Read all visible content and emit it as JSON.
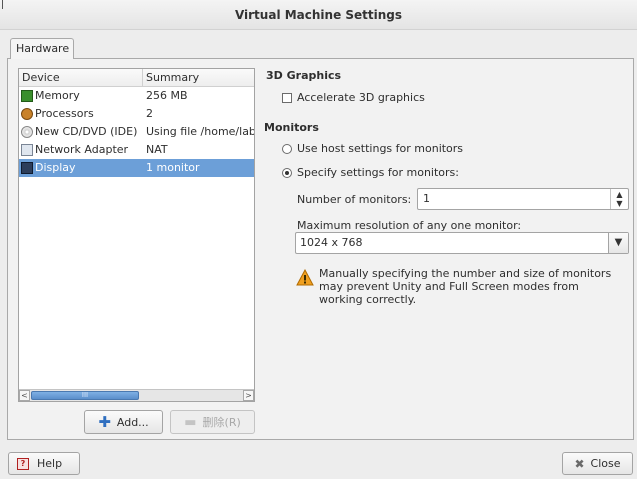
{
  "window": {
    "title": "Virtual Machine Settings"
  },
  "tabs": [
    {
      "label": "Hardware"
    }
  ],
  "device_list": {
    "headers": {
      "device": "Device",
      "summary": "Summary"
    },
    "rows": [
      {
        "device": "Memory",
        "summary": "256 MB",
        "icon": "memory-icon"
      },
      {
        "device": "Processors",
        "summary": "2",
        "icon": "processor-icon"
      },
      {
        "device": "New CD/DVD (IDE)",
        "summary": "Using file /home/labu",
        "icon": "cd-dvd-icon"
      },
      {
        "device": "Network Adapter",
        "summary": "NAT",
        "icon": "network-adapter-icon"
      },
      {
        "device": "Display",
        "summary": "1 monitor",
        "icon": "display-icon",
        "selected": true
      }
    ],
    "scroll_thumb": "III"
  },
  "buttons": {
    "add": "Add...",
    "remove": "删除(R)",
    "help": "Help",
    "close": "Close"
  },
  "graphics": {
    "title": "3D Graphics",
    "accelerate_label": "Accelerate 3D graphics",
    "accelerate_checked": false
  },
  "monitors": {
    "title": "Monitors",
    "use_host_label": "Use host settings for monitors",
    "specify_label": "Specify settings for monitors:",
    "selected_option": "specify",
    "number_label": "Number of monitors:",
    "number_value": "1",
    "max_res_label": "Maximum resolution of any one monitor:",
    "max_res_value": "1024 x 768",
    "warning_text": "Manually specifying the number and size of monitors may prevent Unity and Full Screen modes from working correctly."
  }
}
